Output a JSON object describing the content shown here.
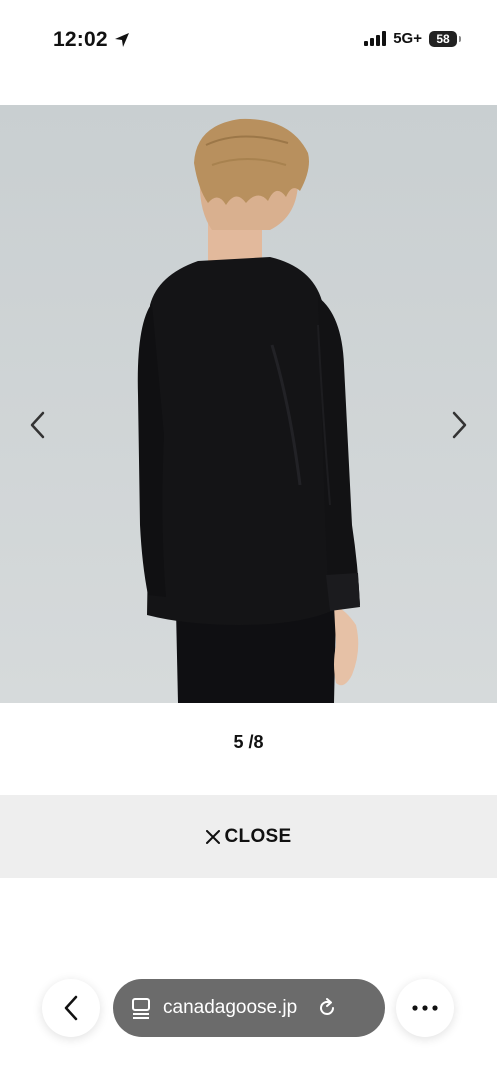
{
  "status_bar": {
    "time": "12:02",
    "network": "5G+",
    "battery": "58"
  },
  "viewer": {
    "counter": "5 /8",
    "close_label": "CLOSE",
    "prev_icon": "chevron-left-icon",
    "next_icon": "chevron-right-icon",
    "background_color": "#ced3d4"
  },
  "browser": {
    "url": "canadagoose.jp",
    "back_icon": "chevron-left-icon",
    "reader_icon": "page-icon",
    "reload_icon": "reload-icon",
    "more_icon": "ellipsis-icon"
  }
}
